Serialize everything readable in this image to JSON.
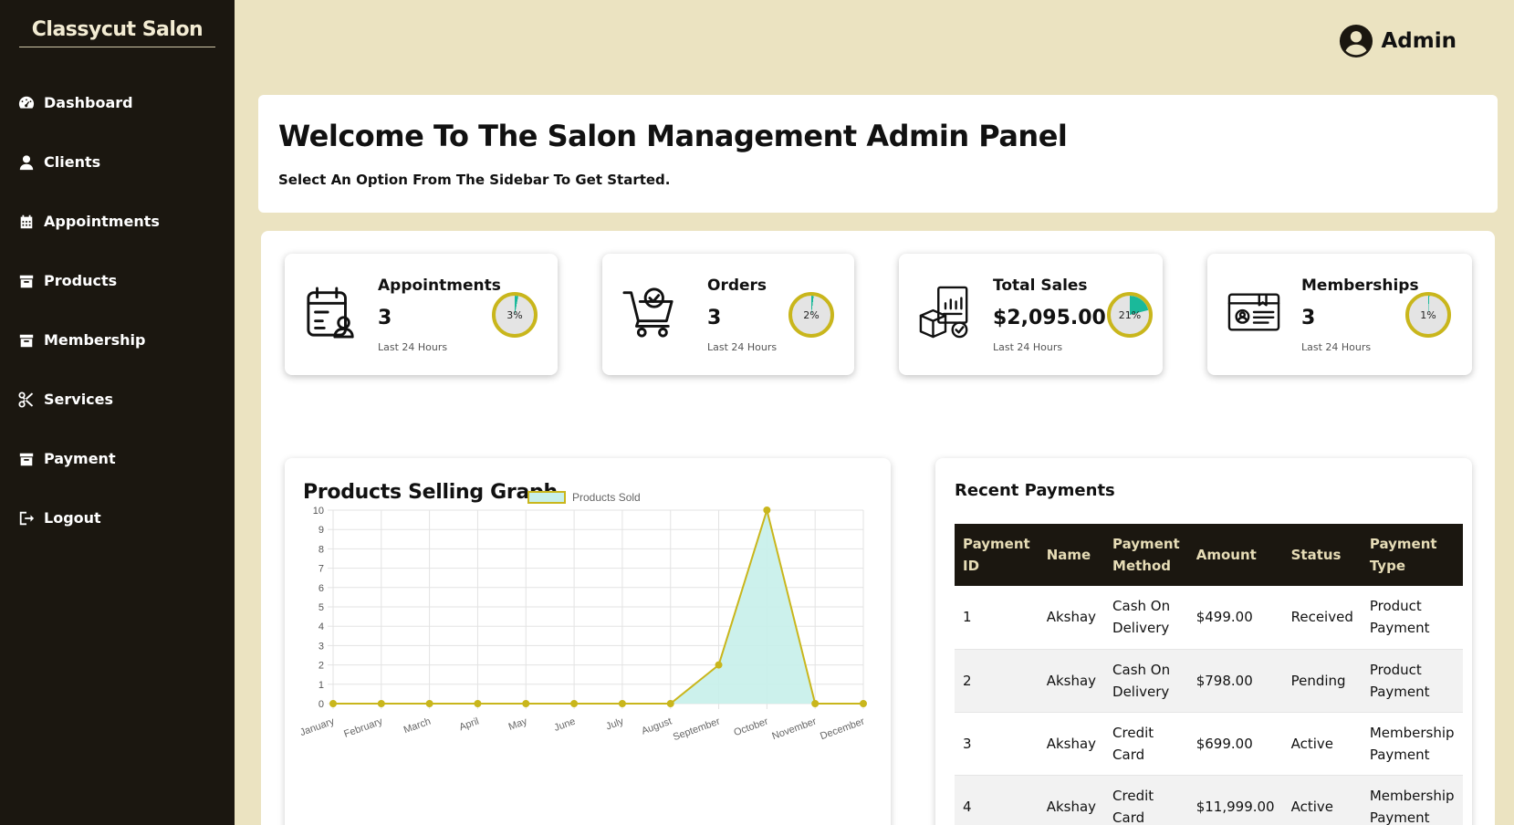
{
  "brand": "Classycut Salon",
  "sidebar": {
    "items": [
      {
        "label": "Dashboard",
        "icon": "gauge-icon"
      },
      {
        "label": "Clients",
        "icon": "user-icon"
      },
      {
        "label": "Appointments",
        "icon": "calendar-icon"
      },
      {
        "label": "Products",
        "icon": "box-icon"
      },
      {
        "label": "Membership",
        "icon": "box-icon"
      },
      {
        "label": "Services",
        "icon": "scissors-icon"
      },
      {
        "label": "Payment",
        "icon": "box-icon"
      },
      {
        "label": "Logout",
        "icon": "logout-icon"
      }
    ]
  },
  "topbar": {
    "user_label": "Admin"
  },
  "welcome": {
    "title": "Welcome To The Salon Management Admin Panel",
    "subtitle": "Select An Option From The Sidebar To Get Started."
  },
  "cards": [
    {
      "title": "Appointments",
      "value": "3",
      "sub": "Last 24 Hours",
      "percent_label": "3%",
      "percent": 3
    },
    {
      "title": "Orders",
      "value": "3",
      "sub": "Last 24 Hours",
      "percent_label": "2%",
      "percent": 2
    },
    {
      "title": "Total Sales",
      "value": "$2,095.00",
      "sub": "Last 24 Hours",
      "percent_label": "21%",
      "percent": 21
    },
    {
      "title": "Memberships",
      "value": "3",
      "sub": "Last 24 Hours",
      "percent_label": "1%",
      "percent": 1
    }
  ],
  "colors": {
    "ring_border": "#c9b61c",
    "ring_fill": "#1ab99a",
    "line": "#c9b61c",
    "area": "#c7efea",
    "sidebar": "#1b1710",
    "page_bg": "#ebe3c1"
  },
  "chart_data": {
    "type": "area",
    "title": "Products Selling Graph",
    "categories": [
      "January",
      "February",
      "March",
      "April",
      "May",
      "June",
      "July",
      "August",
      "September",
      "October",
      "November",
      "December"
    ],
    "series": [
      {
        "name": "Products Sold",
        "values": [
          0,
          0,
          0,
          0,
          0,
          0,
          0,
          0,
          2,
          10,
          0,
          0
        ]
      }
    ],
    "ylim": [
      0,
      10
    ],
    "yticks": [
      0,
      1,
      2,
      3,
      4,
      5,
      6,
      7,
      8,
      9,
      10
    ],
    "grid": true,
    "legend": "top-center"
  },
  "payments": {
    "title": "Recent Payments",
    "columns": [
      "Payment ID",
      "Name",
      "Payment Method",
      "Amount",
      "Status",
      "Payment Type"
    ],
    "rows": [
      [
        "1",
        "Akshay",
        "Cash On Delivery",
        "$499.00",
        "Received",
        "Product Payment"
      ],
      [
        "2",
        "Akshay",
        "Cash On Delivery",
        "$798.00",
        "Pending",
        "Product Payment"
      ],
      [
        "3",
        "Akshay",
        "Credit Card",
        "$699.00",
        "Active",
        "Membership Payment"
      ],
      [
        "4",
        "Akshay",
        "Credit Card",
        "$11,999.00",
        "Active",
        "Membership Payment"
      ]
    ]
  }
}
